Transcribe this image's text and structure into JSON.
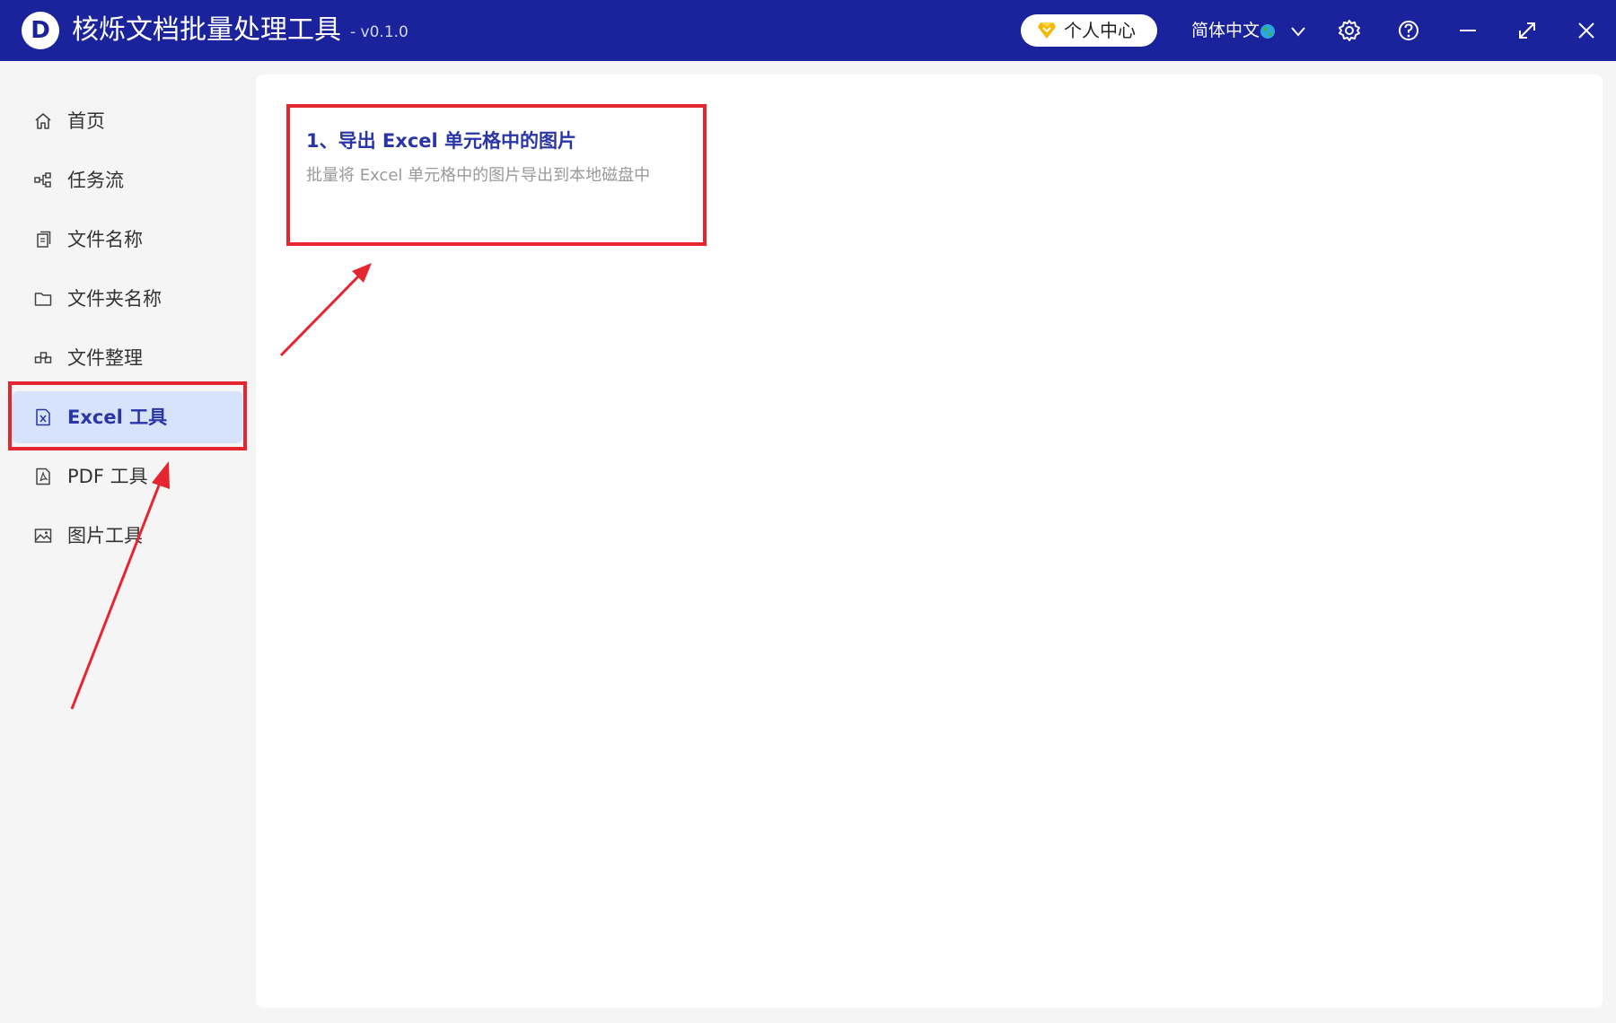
{
  "app": {
    "logo_letter": "D",
    "title": "核烁文档批量处理工具",
    "version": "- v0.1.0",
    "brand_color": "#1a239c"
  },
  "header": {
    "user_center_label": "个人中心",
    "language_label": "简体中文",
    "icons": [
      "diamond-icon",
      "globe-icon",
      "chevron-down-icon",
      "gear-icon",
      "help-icon",
      "minimize-icon",
      "maximize-icon",
      "close-icon"
    ]
  },
  "sidebar": {
    "items": [
      {
        "label": "首页",
        "icon": "home-icon",
        "active": false
      },
      {
        "label": "任务流",
        "icon": "workflow-icon",
        "active": false
      },
      {
        "label": "文件名称",
        "icon": "file-copy-icon",
        "active": false
      },
      {
        "label": "文件夹名称",
        "icon": "folder-icon",
        "active": false
      },
      {
        "label": "文件整理",
        "icon": "organize-icon",
        "active": false
      },
      {
        "label": "Excel 工具",
        "icon": "excel-file-icon",
        "active": true
      },
      {
        "label": "PDF 工具",
        "icon": "pdf-file-icon",
        "active": false
      },
      {
        "label": "图片工具",
        "icon": "image-icon",
        "active": false
      }
    ]
  },
  "main": {
    "cards": [
      {
        "title": "1、导出 Excel 单元格中的图片",
        "description": "批量将 Excel 单元格中的图片导出到本地磁盘中"
      }
    ]
  },
  "annotations": {
    "highlight_color": "#e52530"
  }
}
